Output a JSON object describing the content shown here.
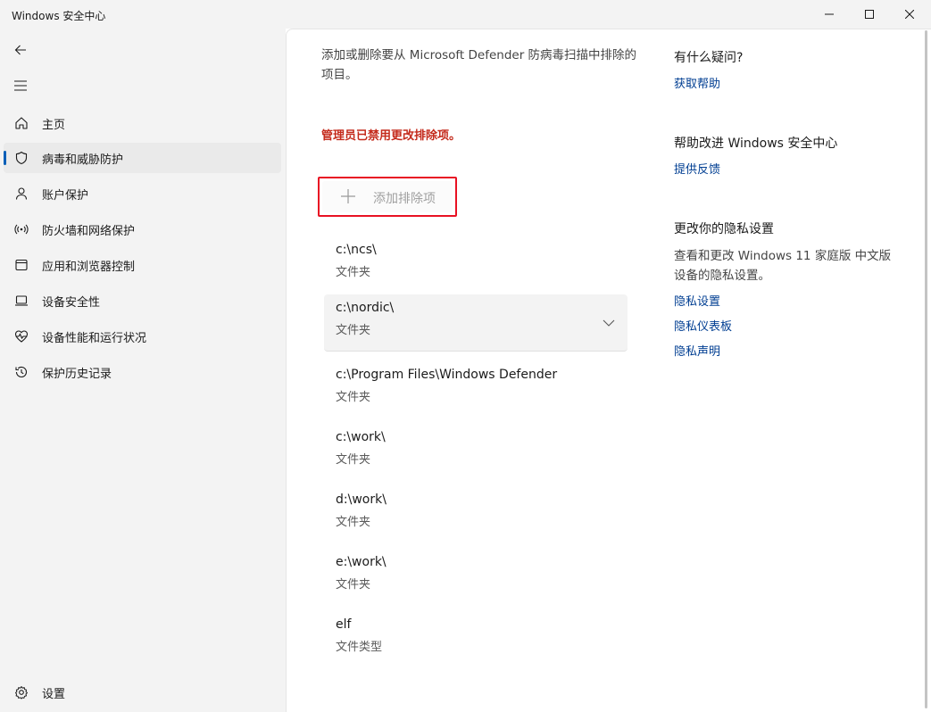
{
  "window": {
    "title": "Windows 安全中心"
  },
  "sidebar": {
    "items": [
      {
        "label": "主页",
        "icon": "home-icon"
      },
      {
        "label": "病毒和威胁防护",
        "icon": "shield-icon",
        "selected": true
      },
      {
        "label": "账户保护",
        "icon": "person-icon"
      },
      {
        "label": "防火墙和网络保护",
        "icon": "wifi-icon"
      },
      {
        "label": "应用和浏览器控制",
        "icon": "app-window-icon"
      },
      {
        "label": "设备安全性",
        "icon": "laptop-icon"
      },
      {
        "label": "设备性能和运行状况",
        "icon": "heart-pulse-icon"
      },
      {
        "label": "保护历史记录",
        "icon": "history-icon"
      }
    ],
    "settings_label": "设置"
  },
  "main": {
    "intro": "添加或删除要从 Microsoft Defender 防病毒扫描中排除的项目。",
    "warning": "管理员已禁用更改排除项。",
    "add_button_label": "添加排除项",
    "exclusions": [
      {
        "path": "c:\\ncs\\",
        "type": "文件夹"
      },
      {
        "path": "c:\\nordic\\",
        "type": "文件夹",
        "hovered": true
      },
      {
        "path": "c:\\Program Files\\Windows Defender",
        "type": "文件夹"
      },
      {
        "path": "c:\\work\\",
        "type": "文件夹"
      },
      {
        "path": "d:\\work\\",
        "type": "文件夹"
      },
      {
        "path": "e:\\work\\",
        "type": "文件夹"
      },
      {
        "path": "elf",
        "type": "文件类型"
      }
    ]
  },
  "right_panel": {
    "question_heading": "有什么疑问?",
    "get_help_link": "获取帮助",
    "improve_heading": "帮助改进 Windows 安全中心",
    "feedback_link": "提供反馈",
    "privacy_heading": "更改你的隐私设置",
    "privacy_text": "查看和更改 Windows 11 家庭版 中文版 设备的隐私设置。",
    "privacy_settings_link": "隐私设置",
    "privacy_dashboard_link": "隐私仪表板",
    "privacy_statement_link": "隐私声明"
  },
  "colors": {
    "accent": "#005fb8",
    "link": "#003e92",
    "warning": "#c42b1c",
    "highlight_box": "#e81123"
  }
}
